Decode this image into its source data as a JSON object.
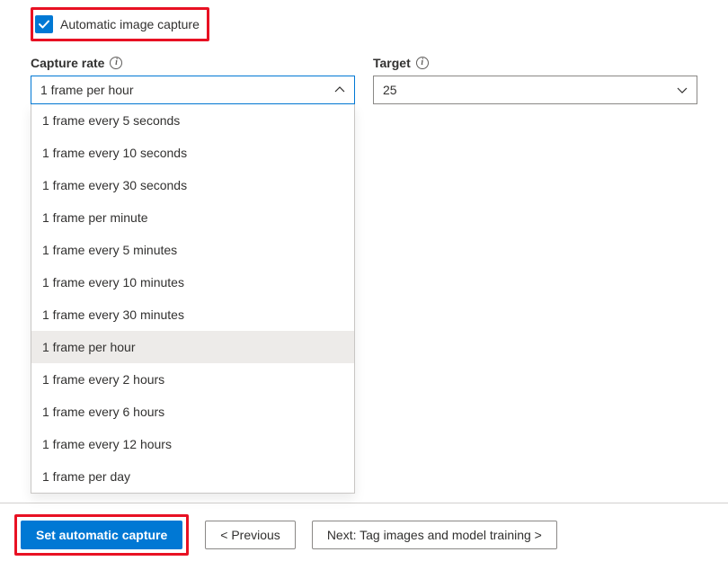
{
  "checkbox": {
    "label": "Automatic image capture",
    "checked": true
  },
  "capture_rate": {
    "label": "Capture rate",
    "selected": "1 frame per hour",
    "options": [
      "1 frame every 5 seconds",
      "1 frame every 10 seconds",
      "1 frame every 30 seconds",
      "1 frame per minute",
      "1 frame every 5 minutes",
      "1 frame every 10 minutes",
      "1 frame every 30 minutes",
      "1 frame per hour",
      "1 frame every 2 hours",
      "1 frame every 6 hours",
      "1 frame every 12 hours",
      "1 frame per day"
    ]
  },
  "target": {
    "label": "Target",
    "value": "25"
  },
  "footer": {
    "primary": "Set automatic capture",
    "previous": "<  Previous",
    "next": "Next: Tag images and model training  >"
  },
  "colors": {
    "accent": "#0078d4",
    "highlight": "#e81123"
  }
}
